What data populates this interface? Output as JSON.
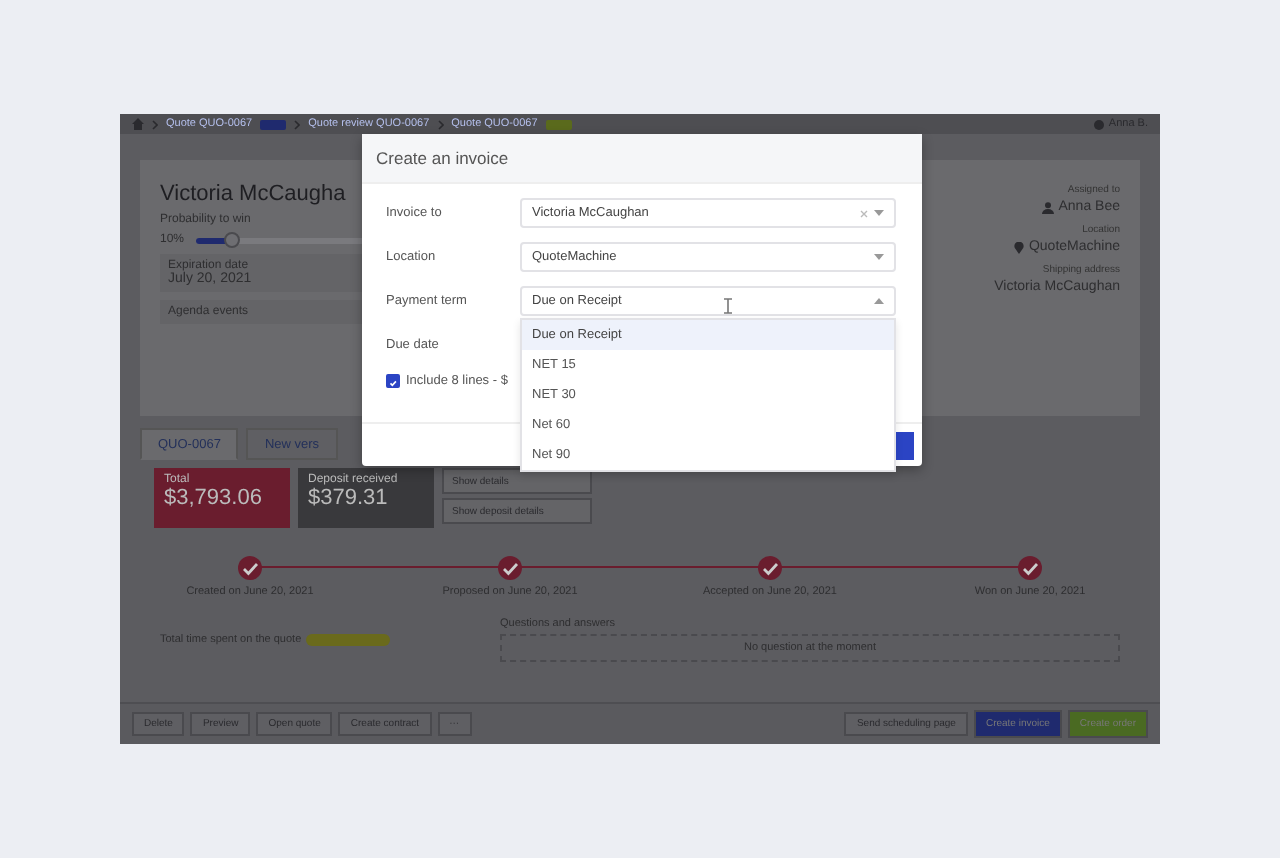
{
  "breadcrumb": {
    "items": [
      {
        "label": "Quote QUO-0067",
        "badge": true
      },
      {
        "label": "Quote review QUO-0067",
        "badge": false
      },
      {
        "label": "Quote QUO-0067",
        "badge": true
      }
    ],
    "user": "Anna B."
  },
  "quote": {
    "customer": "Victoria McCaugha",
    "probability_label": "Probability to win",
    "probability": "10%",
    "level": 0.15,
    "expiration_label": "Expiration date",
    "expiration": "July 20, 2021",
    "agenda_label": "Agenda events",
    "details": [
      {
        "label": "Assigned to",
        "value": "Anna Bee",
        "kind": "person"
      },
      {
        "label": "Location",
        "value": "QuoteMachine",
        "kind": "pin"
      },
      {
        "label": "Shipping address",
        "value": "Victoria McCaughan",
        "kind": "plain"
      }
    ]
  },
  "tabs": [
    {
      "label": "QUO-0067",
      "selected": true
    },
    {
      "label": "New vers",
      "selected": false
    }
  ],
  "totals": [
    {
      "label": "Total",
      "amount": "$3,793.06",
      "kind": "total"
    },
    {
      "label": "Deposit received",
      "amount": "$379.31",
      "kind": "deposit"
    }
  ],
  "detail_buttons": [
    "Show details",
    "Show deposit details"
  ],
  "timeline": [
    "Created on June 20, 2021",
    "Proposed on June 20, 2021",
    "Accepted on June 20, 2021",
    "Won on June 20, 2021"
  ],
  "time_spent_label": "Total time spent on the quote",
  "qa": {
    "title": "Questions and answers",
    "empty": "No question at the moment"
  },
  "toolbar": {
    "left": [
      "Delete",
      "Preview",
      "Open quote",
      "Create contract",
      "···"
    ],
    "right": [
      {
        "label": "Send scheduling page",
        "kind": "plain"
      },
      {
        "label": "Create invoice",
        "kind": "primary"
      },
      {
        "label": "Create order",
        "kind": "success"
      }
    ]
  },
  "modal": {
    "title": "Create an invoice",
    "fields": [
      {
        "label": "Invoice to",
        "value": "Victoria McCaughan",
        "clearable": true,
        "open": false
      },
      {
        "label": "Location",
        "value": "QuoteMachine",
        "clearable": false,
        "open": false
      },
      {
        "label": "Payment term",
        "value": "Due on Receipt",
        "clearable": false,
        "open": true
      },
      {
        "label": "Due date"
      }
    ],
    "include": {
      "label": "Include 8 lines - $",
      "checked": true
    },
    "options": [
      {
        "label": "Due on Receipt",
        "selected": true
      },
      {
        "label": "NET 15",
        "selected": false
      },
      {
        "label": "NET 30",
        "selected": false
      },
      {
        "label": "Net 60",
        "selected": false
      },
      {
        "label": "Net 90",
        "selected": false
      }
    ]
  }
}
